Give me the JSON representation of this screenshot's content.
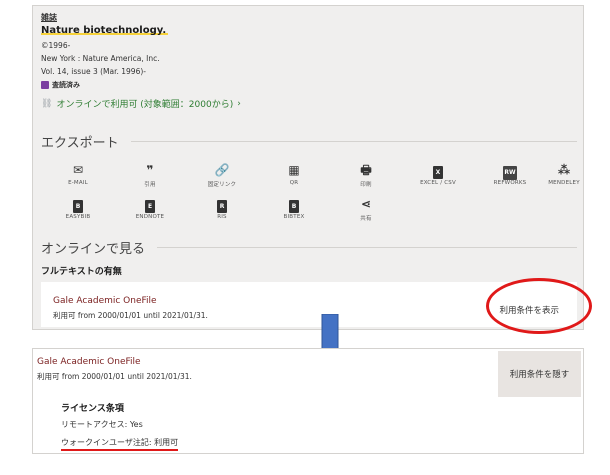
{
  "journal": {
    "type_label": "雑誌",
    "title": "Nature biotechnology.",
    "year": "©1996-",
    "publisher": "New York : Nature America, Inc.",
    "volume": "Vol. 14, issue 3 (Mar. 1996)-",
    "peer_reviewed": "査読済み",
    "online_link": "オンラインで利用可 (対象範囲：2000から)",
    "online_link_chevron": "›"
  },
  "export": {
    "heading": "エクスポート",
    "buttons": [
      {
        "label": "E-MAIL",
        "icon": "✉"
      },
      {
        "label": "引用",
        "icon": "❞"
      },
      {
        "label": "固定リンク",
        "icon": "🔗"
      },
      {
        "label": "QR",
        "icon": "▦"
      },
      {
        "label": "印刷",
        "icon": "🖶"
      },
      {
        "label": "EXCEL / CSV",
        "icon": "X"
      },
      {
        "label": "REFWORKS",
        "icon": "RW"
      },
      {
        "label": "MENDELEY",
        "icon": "⁂"
      },
      {
        "label": "EASYBIB",
        "icon": "B"
      },
      {
        "label": "ENDNOTE",
        "icon": "E"
      },
      {
        "label": "RIS",
        "icon": "R"
      },
      {
        "label": "BIBTEX",
        "icon": "B"
      },
      {
        "label": "共有",
        "icon": "⋖"
      }
    ]
  },
  "online": {
    "heading": "オンラインで見る",
    "fulltext_heading": "フルテキストの有無",
    "provider_name": "Gale Academic OneFile",
    "coverage": "利用可 from 2000/01/01 until 2021/01/31.",
    "show_terms": "利用条件を表示",
    "hide_terms": "利用条件を隠す"
  },
  "license": {
    "title": "ライセンス条項",
    "remote_access": "リモートアクセス: Yes",
    "walkin_note": "ウォークインユーザ注記: 利用可"
  },
  "colors": {
    "highlight": "#f7d23a",
    "annotation_red": "#e01919",
    "arrow_blue": "#4472c4",
    "provider_link": "#7a1f1f",
    "online_green": "#2e7d32"
  }
}
